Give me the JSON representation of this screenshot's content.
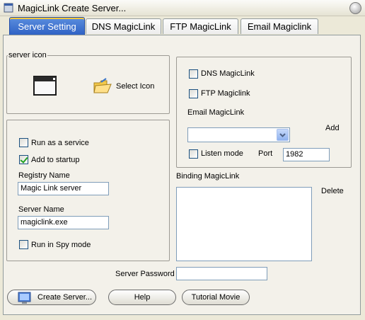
{
  "window": {
    "title": "MagicLink Create Server..."
  },
  "tabs": [
    {
      "label": "Server Setting"
    },
    {
      "label": "DNS MagicLink"
    },
    {
      "label": "FTP MagicLink"
    },
    {
      "label": "Email Magiclink"
    }
  ],
  "server_icon": {
    "group_label": "server icon",
    "select_label": "Select Icon"
  },
  "service": {
    "run_as_service": {
      "label": "Run as a service",
      "checked": false
    },
    "add_to_startup": {
      "label": "Add to startup",
      "checked": true
    },
    "registry_name": {
      "label": "Registry Name",
      "value": "Magic Link server"
    },
    "server_name": {
      "label": "Server Name",
      "value": "magiclink.exe"
    },
    "spy_mode": {
      "label": "Run in Spy mode",
      "checked": false
    }
  },
  "links": {
    "dns": {
      "label": "DNS MagicLink",
      "checked": false
    },
    "ftp": {
      "label": "FTP Magiclink",
      "checked": false
    },
    "email_label": "Email MagicLink",
    "email_value": "",
    "add_label": "Add",
    "listen": {
      "label": "Listen mode",
      "checked": false
    },
    "port_label": "Port",
    "port_value": "1982"
  },
  "binding": {
    "label": "Binding MagicLink",
    "delete_label": "Delete",
    "items": []
  },
  "password": {
    "label": "Server Password",
    "value": ""
  },
  "buttons": {
    "create": "Create Server...",
    "help": "Help",
    "tutorial": "Tutorial Movie"
  },
  "colors": {
    "active_tab": "#3a6fd0",
    "tab_highlight": "#ffc83a",
    "background": "#ece9d8"
  }
}
